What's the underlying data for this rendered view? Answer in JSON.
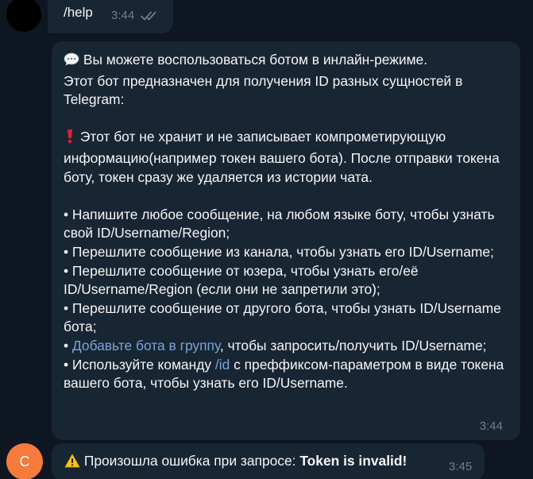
{
  "messages": {
    "help": {
      "text": "/help",
      "time": "3:44",
      "status_icon": "double-check-icon"
    },
    "info": {
      "line1": "Вы можете воспользоваться ботом в инлайн-режиме.",
      "line1_icon": "speech-bubble-icon",
      "line2": "Этот бот предназначен для получения ID разных сущностей в Telegram:",
      "warning_icon": "red-exclamation-icon",
      "warning": "Этот бот не хранит и не записывает компрометирующую информацию(например токен вашего бота). После отправки токена боту, токен сразу же удаляется из истории чата.",
      "bullets": [
        "• Напишите любое сообщение, на любом языке боту, чтобы узнать свой ID/Username/Region;",
        "• Перешлите сообщение из канала, чтобы узнать его ID/Username;",
        "• Перешлите сообщение от юзера, чтобы узнать его/её ID/Username/Region (если они не запретили это);",
        "• Перешлите сообщение от другого бота, чтобы узнать ID/Username бота;"
      ],
      "bullet5_prefix": "• ",
      "bullet5_link": "Добавьте бота в группу",
      "bullet5_suffix": ", чтобы запросить/получить ID/Username;",
      "bullet6_prefix": "• Используйте команду ",
      "bullet6_link": "/id",
      "bullet6_suffix": " с преффиксом-параметром в виде токена вашего бота, чтобы узнать его ID/Username.",
      "time": "3:44"
    },
    "error": {
      "icon": "warning-icon",
      "text": "Произошла ошибка при запросе: ",
      "bold": "Token is invalid!",
      "time": "3:45"
    }
  },
  "avatars": {
    "bot_letter": "C"
  },
  "colors": {
    "background": "#0e1621",
    "bubble": "#182533",
    "link": "#7ca4d6",
    "meta": "#6d7f8f",
    "bot_avatar": "#f57a3b"
  }
}
